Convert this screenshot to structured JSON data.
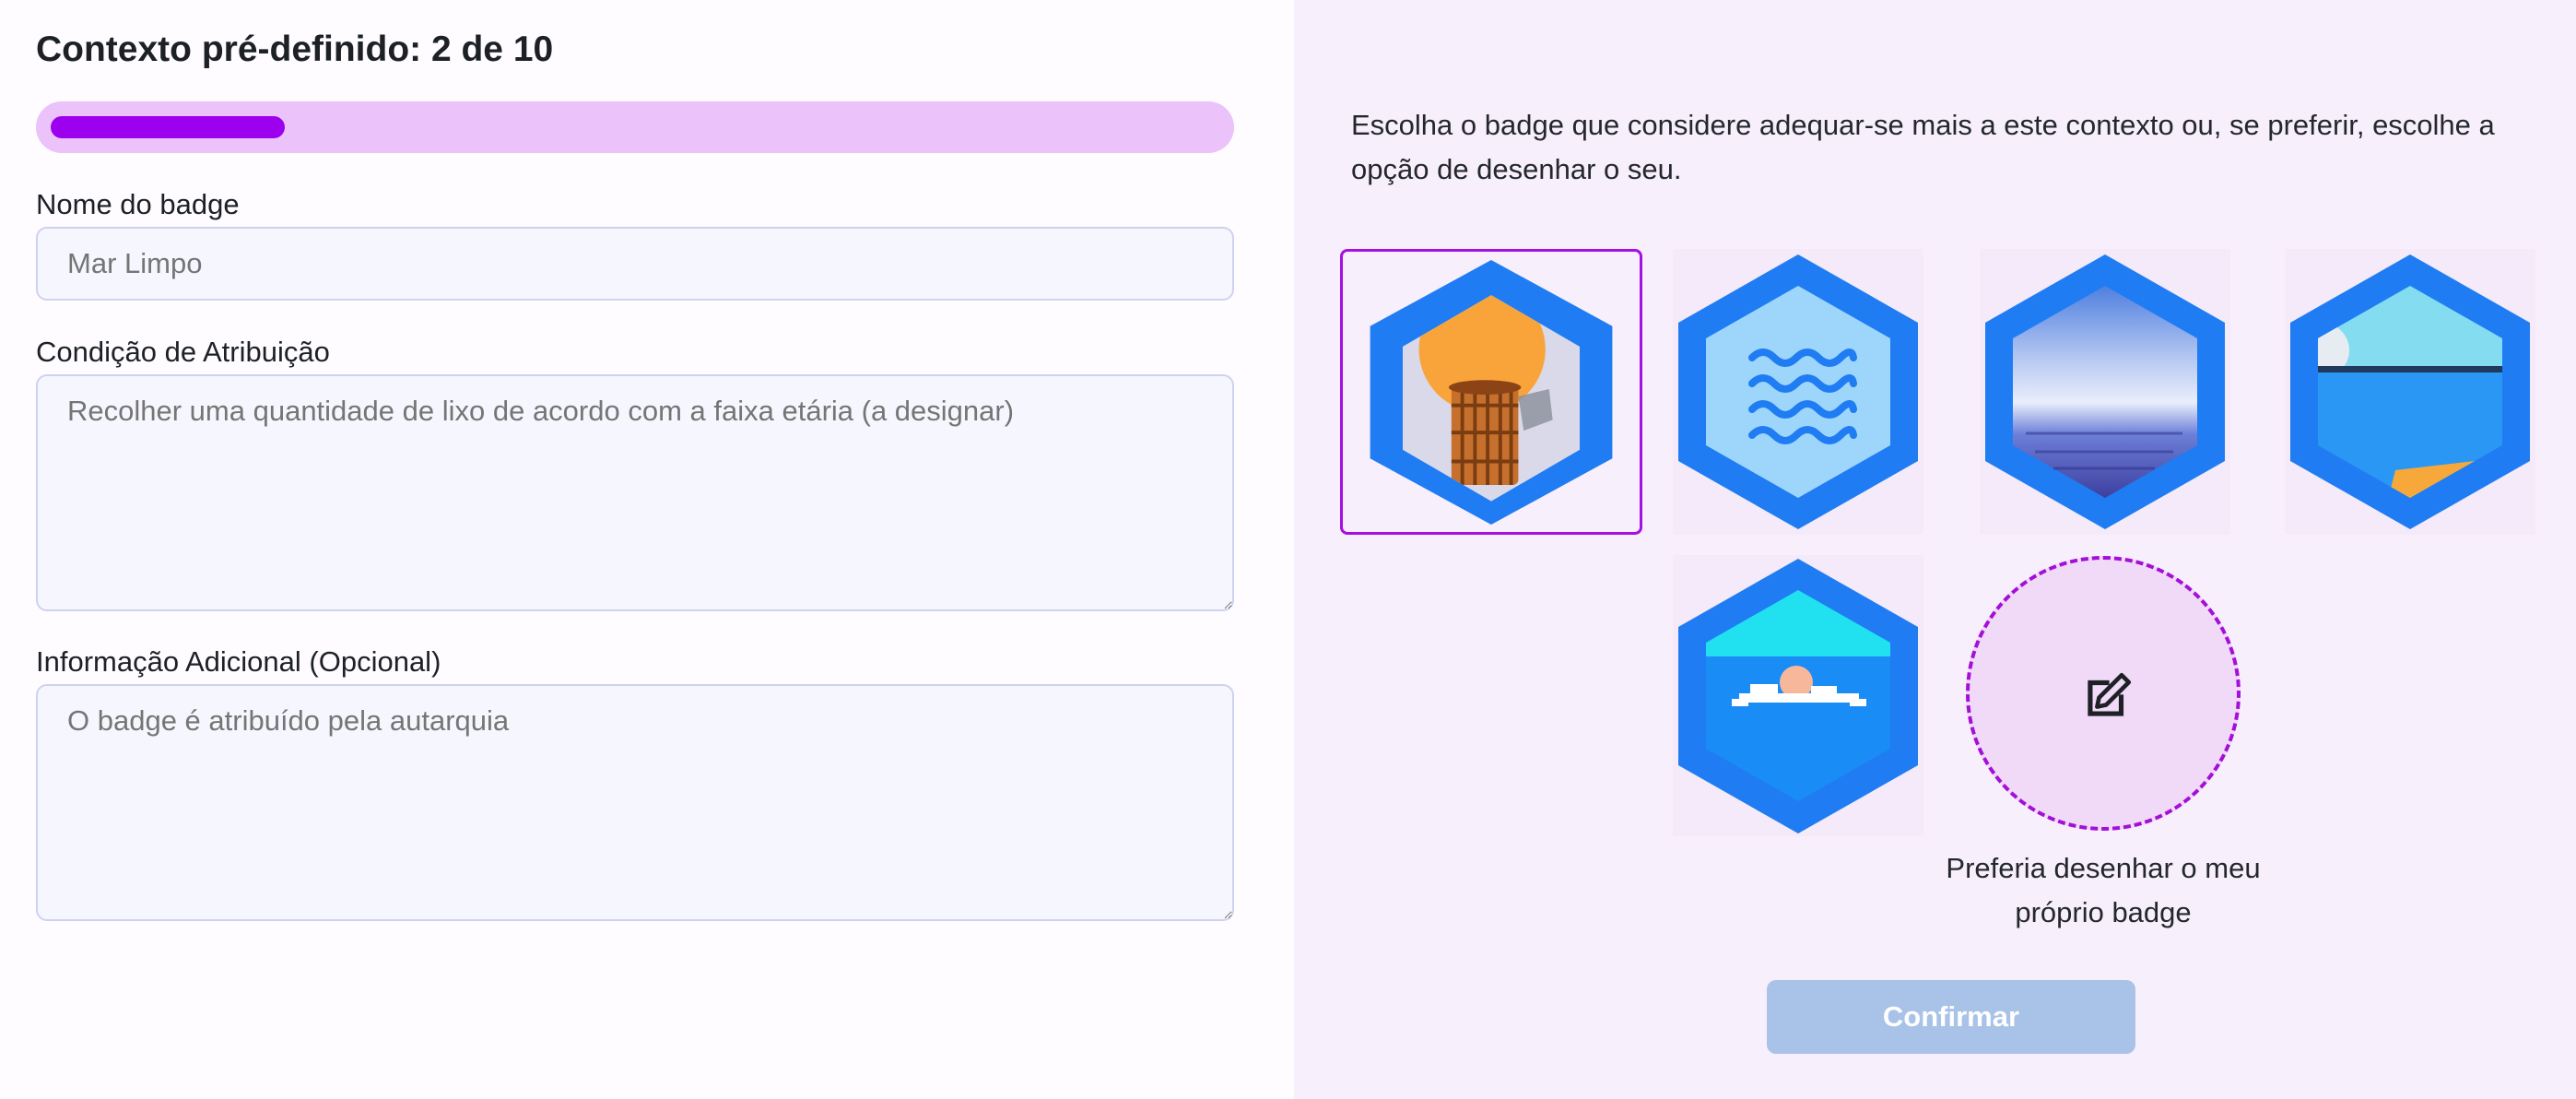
{
  "form": {
    "title": "Contexto pré-definido: 2 de 10",
    "progress": 0.2,
    "progress_color": "#9c00ee",
    "badge_name": {
      "label": "Nome do badge",
      "value": "Mar Limpo"
    },
    "condition": {
      "label": "Condição de Atribuição",
      "value": "Recolher uma quantidade de lixo de acordo com a faixa etária (a designar)"
    },
    "additional_info": {
      "label": "Informação Adicional (Opcional)",
      "value": "O badge é atribuído pela autarquia"
    }
  },
  "badge_picker": {
    "instructions": "Escolha o badge que considere adequar-se mais a este contexto ou, se preferir, escolhe a opção de desenhar o seu.",
    "options": [
      {
        "icon": "sun-basket-hexagon-icon",
        "selected": true
      },
      {
        "icon": "waves-hexagon-icon",
        "selected": false
      },
      {
        "icon": "sea-gradient-hexagon-icon",
        "selected": false
      },
      {
        "icon": "beach-horizon-hexagon-icon",
        "selected": false
      },
      {
        "icon": "swimmer-clouds-hexagon-icon",
        "selected": false
      }
    ],
    "draw_own": {
      "icon": "edit-icon",
      "label": "Preferia desenhar o meu próprio badge"
    },
    "confirm_label": "Confirmar"
  },
  "colors": {
    "accent": "#9c00ee",
    "badge_blue": "#1f7cf3",
    "selected_border": "#a60fe0",
    "confirm_disabled": "#a9c2e8",
    "right_panel_bg": "#f8effd"
  }
}
